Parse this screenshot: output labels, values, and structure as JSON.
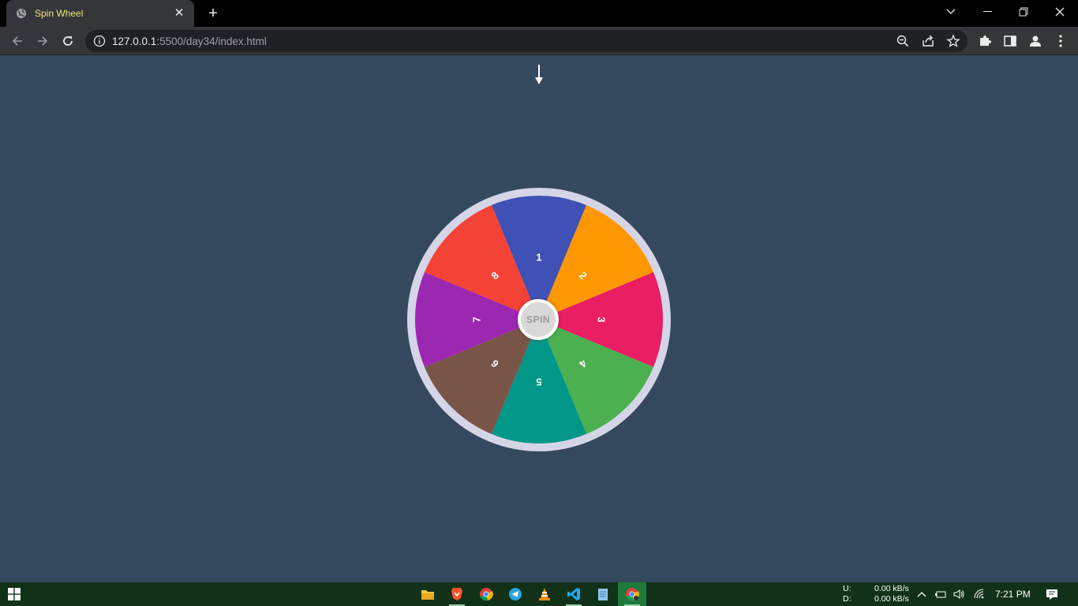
{
  "browser": {
    "tab_title": "Spin Wheel",
    "tab_close": "✕",
    "new_tab": "+",
    "url_host": "127.0.0.1",
    "url_path": ":5500/day34/index.html"
  },
  "wheel": {
    "spin_label": "SPIN",
    "segments": [
      {
        "label": "1",
        "color": "#3f51b5"
      },
      {
        "label": "2",
        "color": "#ff9800"
      },
      {
        "label": "3",
        "color": "#e91e63"
      },
      {
        "label": "4",
        "color": "#4caf50"
      },
      {
        "label": "5",
        "color": "#009688"
      },
      {
        "label": "6",
        "color": "#795548"
      },
      {
        "label": "7",
        "color": "#9c27b0"
      },
      {
        "label": "8",
        "color": "#f44336"
      }
    ]
  },
  "taskbar": {
    "net_up_label": "U:",
    "net_up_value": "0.00 kB/s",
    "net_down_label": "D:",
    "net_down_value": "0.00 kB/s",
    "time": "7:21 PM"
  }
}
